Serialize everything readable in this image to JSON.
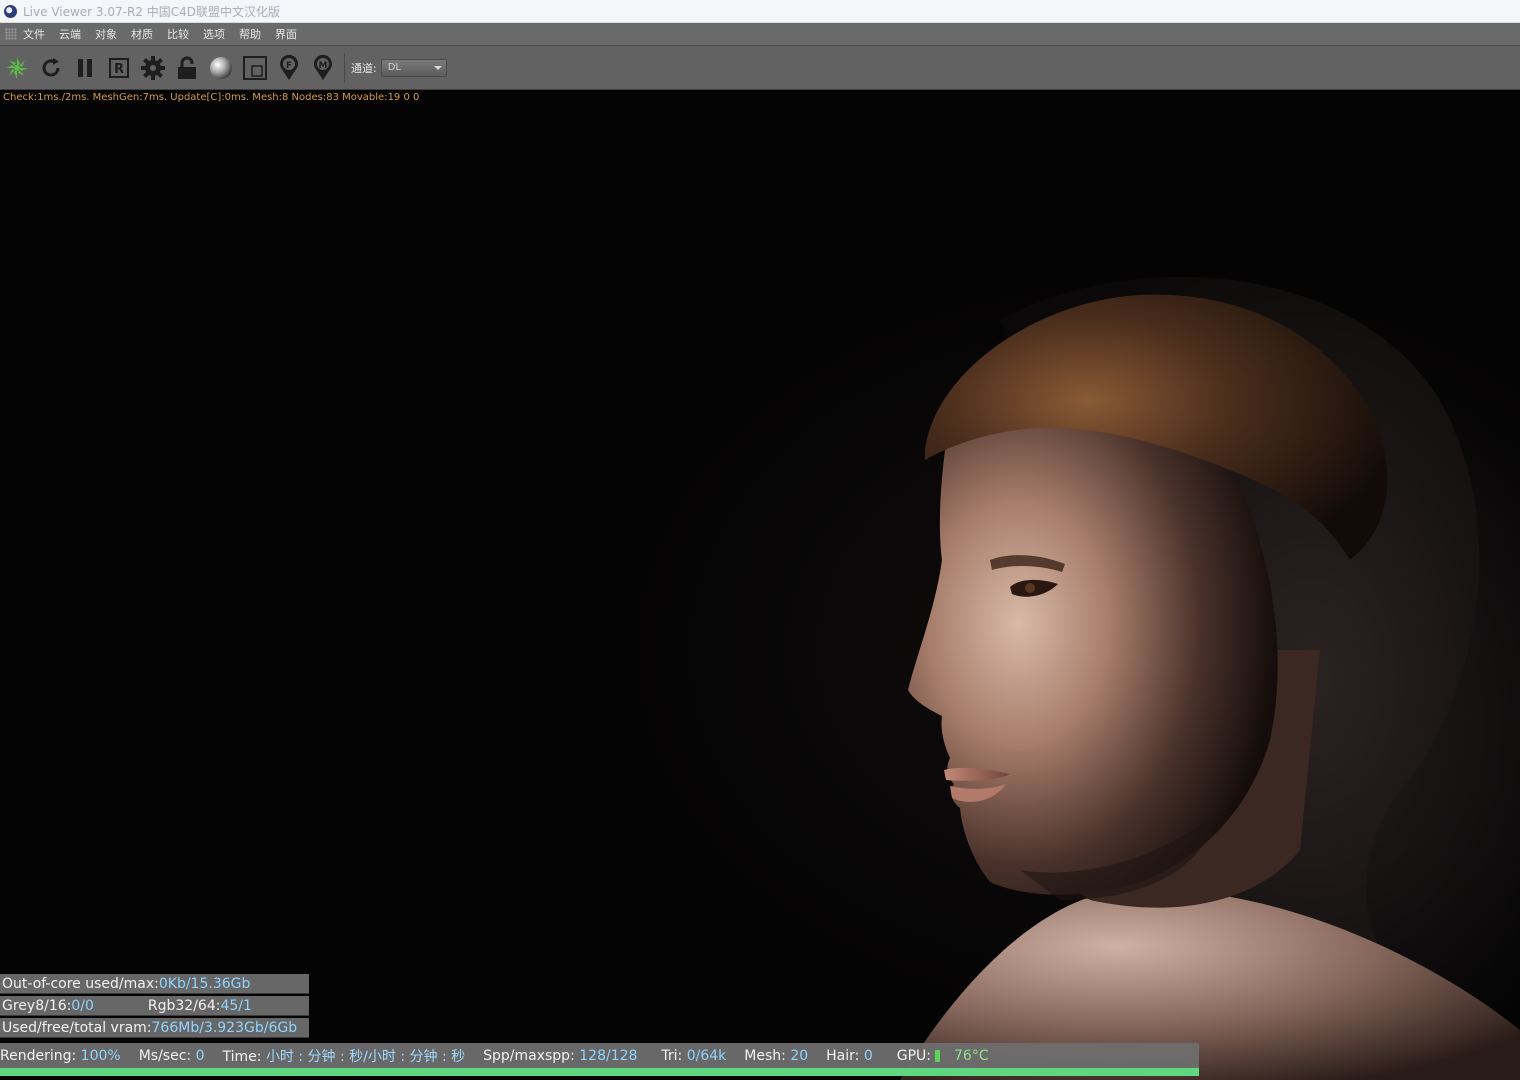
{
  "window": {
    "title": "Live Viewer 3.07-R2 中国C4D联盟中文汉化版"
  },
  "menu": [
    "文件",
    "云端",
    "对象",
    "材质",
    "比较",
    "选项",
    "帮助",
    "界面"
  ],
  "toolbar": {
    "icons": [
      "octane-logo-icon",
      "restart-icon",
      "pause-icon",
      "recalculate-r-icon",
      "settings-gear-icon",
      "lock-icon",
      "material-sphere-icon",
      "region-render-icon",
      "focus-pick-f-icon",
      "material-pick-m-icon"
    ],
    "channel_label": "通道:",
    "channel_value": "DL"
  },
  "viewport": {
    "stats_line": "Check:1ms./2ms. MeshGen:7ms. Update[C]:0ms. Mesh:8 Nodes:83 Movable:19  0 0"
  },
  "hud": {
    "ooc_label": "Out-of-core used/max:",
    "ooc_value": "0Kb/15.36Gb",
    "grey_label": "Grey8/16: ",
    "grey_value": "0/0",
    "rgb_label": "Rgb32/64: ",
    "rgb_value": "45/1",
    "vram_label": "Used/free/total vram: ",
    "vram_value": "766Mb/3.923Gb/6Gb"
  },
  "status": {
    "rendering_label": "Rendering: ",
    "rendering_value": "100%",
    "mssec_label": "Ms/sec: ",
    "mssec_value": "0",
    "time_label": "Time: ",
    "time_value": "小时 : 分钟 : 秒/小时 : 分钟 : 秒",
    "spp_label": "Spp/maxspp: ",
    "spp_value": "128/128",
    "tri_label": "Tri: ",
    "tri_value": "0/64k",
    "mesh_label": "Mesh: ",
    "mesh_value": "20",
    "hair_label": "Hair: ",
    "hair_value": "0",
    "gpu_label": "GPU:",
    "gpu_temp": "76°C",
    "progress_percent": 100
  },
  "colors": {
    "accent_green": "#5fd680",
    "stats_orange": "#d49a4a",
    "value_blue": "#8fd3ff"
  }
}
